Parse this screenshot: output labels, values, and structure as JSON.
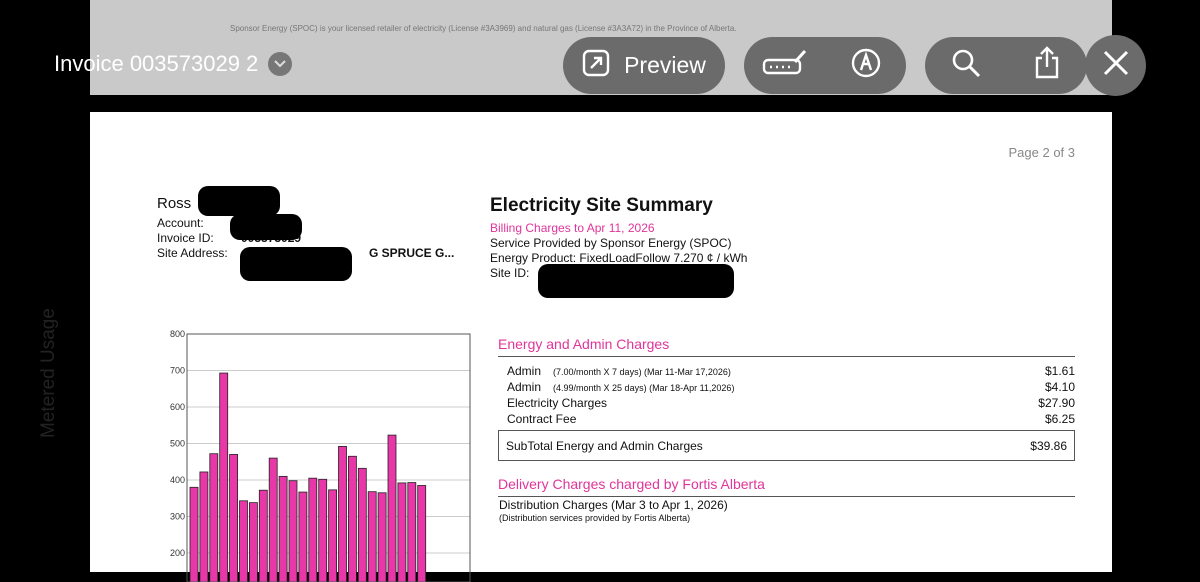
{
  "prev_page_text": "Sponsor Energy (SPOC) is your licensed retailer of electricity (License #3A3969) and natural gas (License #3A3A72) in the Province of Alberta.",
  "toolbar": {
    "title": "Invoice 003573029 2",
    "preview_label": "Preview"
  },
  "page": {
    "page_number": "Page 2 of 3",
    "customer": {
      "name": "Ross",
      "account_label": "Account:",
      "invoice_label": "Invoice ID:",
      "invoice_id": "003573029",
      "site_label": "Site Address:",
      "site_value": "G SPRUCE G..."
    },
    "summary": {
      "title": "Electricity Site Summary",
      "billing": "Billing Charges to Apr 11, 2026",
      "service": "Service Provided by Sponsor Energy (SPOC)",
      "product": "Energy Product: FixedLoadFollow 7.270 ¢ / kWh",
      "site_id_label": "Site ID:"
    },
    "energy_section": {
      "title": "Energy and Admin Charges",
      "rows": [
        {
          "label": "Admin",
          "detail": "(7.00/month X 7 days) (Mar 11-Mar 17,2026)",
          "amount": "$1.61"
        },
        {
          "label": "Admin",
          "detail": "(4.99/month X 25 days) (Mar 18-Apr 11,2026)",
          "amount": "$4.10"
        },
        {
          "label": "Electricity Charges",
          "detail": "",
          "amount": "$27.90"
        },
        {
          "label": "Contract Fee",
          "detail": "",
          "amount": "$6.25"
        }
      ],
      "subtotal_label": "SubTotal Energy and Admin Charges",
      "subtotal_amount": "$39.86"
    },
    "delivery_section": {
      "title": "Delivery Charges charged by Fortis Alberta",
      "distribution": "Distribution Charges  (Mar 3 to Apr 1, 2026)",
      "distribution_note": "(Distribution services provided by Fortis Alberta)"
    }
  },
  "chart_data": {
    "type": "bar",
    "ylabel": "Metered Usage",
    "yticks": [
      "800",
      "700",
      "600",
      "500",
      "400",
      "300",
      "200"
    ],
    "ylim": [
      200,
      800
    ],
    "values": [
      380,
      422,
      472,
      693,
      470,
      343,
      338,
      372,
      460,
      410,
      398,
      367,
      405,
      402,
      373,
      492,
      465,
      432,
      368,
      365,
      523,
      392,
      393,
      385
    ],
    "bar_color": "#e838a8"
  },
  "colors": {
    "accent": "#e0359a",
    "bar": "#e838a8"
  }
}
